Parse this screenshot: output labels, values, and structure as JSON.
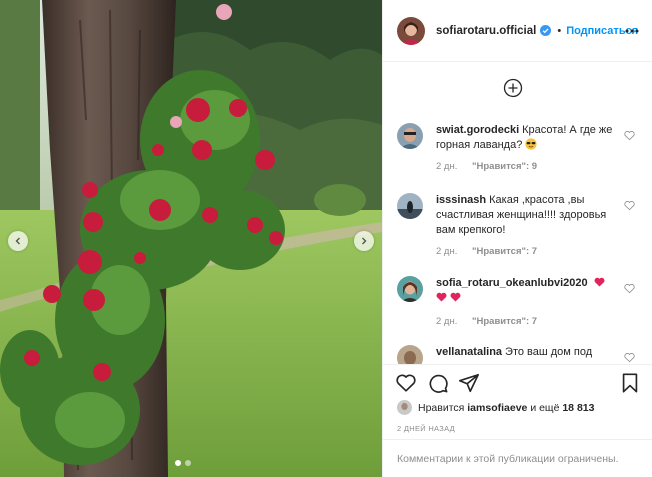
{
  "post": {
    "username": "sofiarotaru.official",
    "separator": "•",
    "follow_label": "Подписаться",
    "verified": true
  },
  "comments": [
    {
      "username": "swiat.gorodecki",
      "text": "Красота! А где же горная лаванда?",
      "emoji": "smiling-face-with-sunglasses",
      "time": "2 дн.",
      "likes": "\"Нравится\": 9"
    },
    {
      "username": "isssinash",
      "text": "Какая ,красота ,вы счастливая женщина!!!! здоровья вам крепкого!",
      "time": "2 дн.",
      "likes": "\"Нравится\": 7"
    },
    {
      "username": "sofia_rotaru_okeanlubvi2020",
      "text": "",
      "emoji": "red-hearts",
      "time": "2 дн.",
      "likes": "\"Нравится\": 7"
    },
    {
      "username": "vellanatalina",
      "text": "Это ваш дом под"
    }
  ],
  "likes": {
    "prefix": "Нравится",
    "user": "iamsofiaeve",
    "middle": "и ещё",
    "count": "18 813"
  },
  "timestamp": "2 дней назад",
  "comments_disabled": "Комментарии к этой публикации ограничены.",
  "carousel": {
    "slides": 2,
    "active_index": 0
  },
  "colors": {
    "accent": "#0095f6",
    "text": "#262626",
    "muted": "#8e8e8e",
    "divider": "#efefef",
    "heart_red": "#ed4956"
  },
  "icons": {
    "like": "heart-icon",
    "comment": "comment-icon",
    "share": "share-icon",
    "save": "bookmark-icon",
    "more": "more-dots-icon",
    "load_more": "plus-circle-icon"
  }
}
